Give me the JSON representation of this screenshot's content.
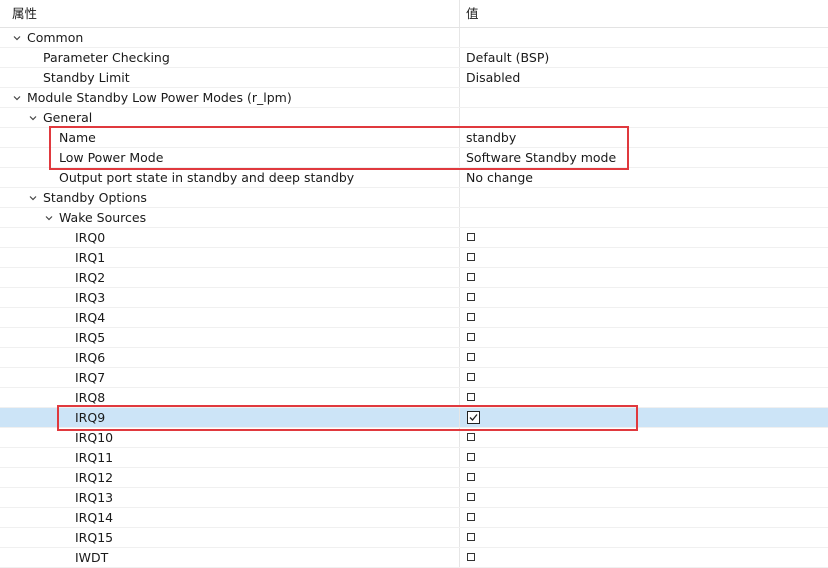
{
  "header": {
    "property_label": "属性",
    "value_label": "值"
  },
  "rows": {
    "common": {
      "label": "Common"
    },
    "parameter_checking": {
      "label": "Parameter Checking",
      "value": "Default (BSP)"
    },
    "standby_limit": {
      "label": "Standby Limit",
      "value": "Disabled"
    },
    "module": {
      "label": "Module Standby Low Power Modes (r_lpm)"
    },
    "general": {
      "label": "General"
    },
    "name": {
      "label": "Name",
      "value": "standby"
    },
    "low_power_mode": {
      "label": "Low Power Mode",
      "value": "Software Standby mode"
    },
    "output_port_state": {
      "label": "Output port state in standby and deep standby",
      "value": "No change"
    },
    "standby_options": {
      "label": "Standby Options"
    },
    "wake_sources": {
      "label": "Wake Sources"
    }
  },
  "wake_items": [
    {
      "label": "IRQ0",
      "checked": false
    },
    {
      "label": "IRQ1",
      "checked": false
    },
    {
      "label": "IRQ2",
      "checked": false
    },
    {
      "label": "IRQ3",
      "checked": false
    },
    {
      "label": "IRQ4",
      "checked": false
    },
    {
      "label": "IRQ5",
      "checked": false
    },
    {
      "label": "IRQ6",
      "checked": false
    },
    {
      "label": "IRQ7",
      "checked": false
    },
    {
      "label": "IRQ8",
      "checked": false
    },
    {
      "label": "IRQ9",
      "checked": true,
      "selected": true
    },
    {
      "label": "IRQ10",
      "checked": false
    },
    {
      "label": "IRQ11",
      "checked": false
    },
    {
      "label": "IRQ12",
      "checked": false
    },
    {
      "label": "IRQ13",
      "checked": false
    },
    {
      "label": "IRQ14",
      "checked": false
    },
    {
      "label": "IRQ15",
      "checked": false
    },
    {
      "label": "IWDT",
      "checked": false
    }
  ],
  "colors": {
    "highlight_border": "#e0393e",
    "selection_bg": "#cce4f7"
  }
}
